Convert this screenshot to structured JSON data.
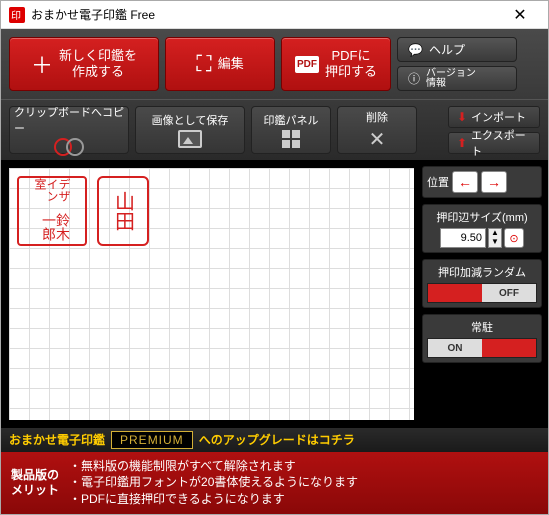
{
  "title": "おまかせ電子印鑑 Free",
  "toolbar": {
    "create": "新しく印鑑を\n作成する",
    "edit": "編集",
    "pdf": "PDFに\n押印する",
    "help": "ヘルプ",
    "version": "バージョン\n情報"
  },
  "tools": {
    "copy": "クリップボードへコピー",
    "save": "画像として保存",
    "panel": "印鑑パネル",
    "delete": "削除",
    "import": "インポート",
    "export": "エクスポート"
  },
  "stamps": {
    "s1_col1": "デザイン室",
    "s1_col2": "鈴木一郎",
    "s2": "山田"
  },
  "panel": {
    "position": "位置",
    "size_label": "押印辺サイズ(mm)",
    "size_value": "9.50",
    "random_label": "押印加減ランダム",
    "random_state": "OFF",
    "resident_label": "常駐",
    "resident_state": "ON"
  },
  "premium": {
    "text1": "おまかせ電子印鑑",
    "badge": "PREMIUM",
    "text2": "へのアップグレードはコチラ",
    "ben_title1": "製品版の",
    "ben_title2": "メリット",
    "b1": "・無料版の機能制限がすべて解除されます",
    "b2": "・電子印鑑用フォントが20書体使えるようになります",
    "b3": "・PDFに直接押印できるようになります"
  }
}
